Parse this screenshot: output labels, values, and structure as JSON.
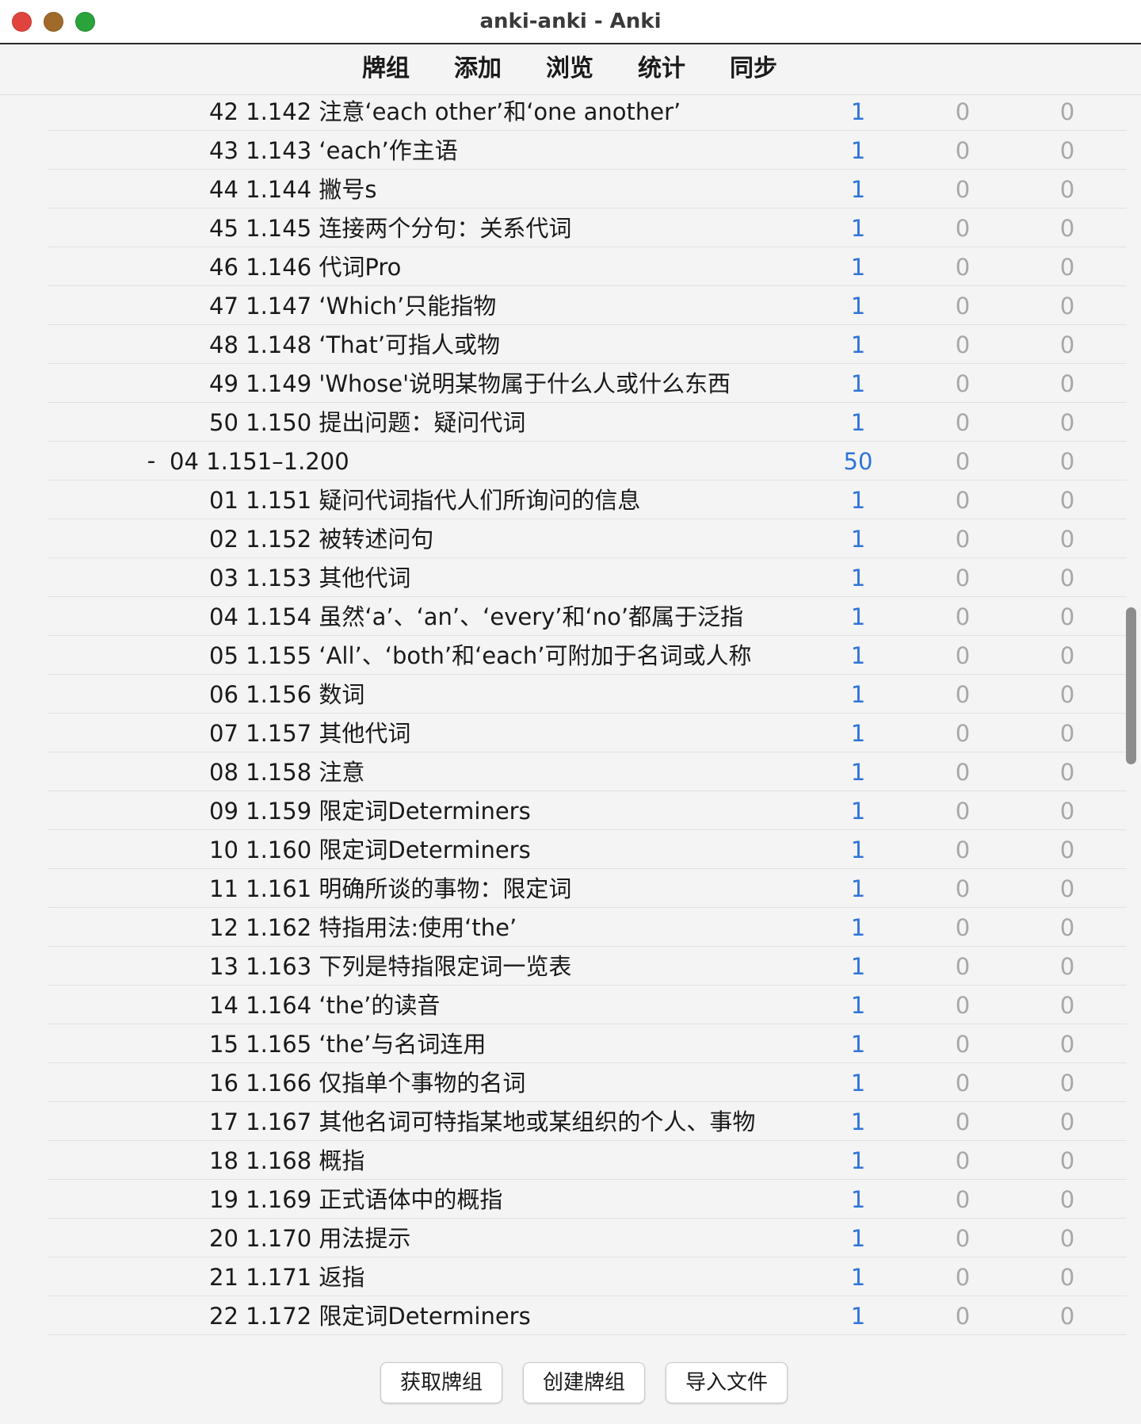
{
  "window": {
    "title": "anki-anki - Anki"
  },
  "toolbar": {
    "items": [
      {
        "label": "牌组"
      },
      {
        "label": "添加"
      },
      {
        "label": "浏览"
      },
      {
        "label": "统计"
      },
      {
        "label": "同步"
      }
    ]
  },
  "decks": {
    "rows": [
      {
        "name": "42 1.142 注意‘each other’和‘one another’",
        "new": "1",
        "learn": "0",
        "due": "0"
      },
      {
        "name": "43 1.143 ‘each’作主语",
        "new": "1",
        "learn": "0",
        "due": "0"
      },
      {
        "name": "44 1.144 撇号s",
        "new": "1",
        "learn": "0",
        "due": "0"
      },
      {
        "name": "45 1.145 连接两个分句：关系代词",
        "new": "1",
        "learn": "0",
        "due": "0"
      },
      {
        "name": "46 1.146 代词Pro",
        "new": "1",
        "learn": "0",
        "due": "0"
      },
      {
        "name": "47 1.147 ‘Which’只能指物",
        "new": "1",
        "learn": "0",
        "due": "0"
      },
      {
        "name": "48 1.148 ‘That’可指人或物",
        "new": "1",
        "learn": "0",
        "due": "0"
      },
      {
        "name": "49 1.149 'Whose'说明某物属于什么人或什么东西",
        "new": "1",
        "learn": "0",
        "due": "0"
      },
      {
        "name": "50 1.150 提出问题：疑问代词",
        "new": "1",
        "learn": "0",
        "due": "0"
      },
      {
        "name": "04 1.151–1.200",
        "new": "50",
        "learn": "0",
        "due": "0",
        "toggle": "-"
      },
      {
        "name": "01 1.151 疑问代词指代人们所询问的信息",
        "new": "1",
        "learn": "0",
        "due": "0"
      },
      {
        "name": "02 1.152 被转述问句",
        "new": "1",
        "learn": "0",
        "due": "0"
      },
      {
        "name": "03 1.153 其他代词",
        "new": "1",
        "learn": "0",
        "due": "0"
      },
      {
        "name": "04 1.154 虽然‘a’、‘an’、‘every’和‘no’都属于泛指",
        "new": "1",
        "learn": "0",
        "due": "0"
      },
      {
        "name": "05 1.155 ‘All’、‘both’和‘each’可附加于名词或人称",
        "new": "1",
        "learn": "0",
        "due": "0"
      },
      {
        "name": "06 1.156 数词",
        "new": "1",
        "learn": "0",
        "due": "0"
      },
      {
        "name": "07 1.157 其他代词",
        "new": "1",
        "learn": "0",
        "due": "0"
      },
      {
        "name": "08 1.158 注意",
        "new": "1",
        "learn": "0",
        "due": "0"
      },
      {
        "name": "09 1.159 限定词Determiners",
        "new": "1",
        "learn": "0",
        "due": "0"
      },
      {
        "name": "10 1.160 限定词Determiners",
        "new": "1",
        "learn": "0",
        "due": "0"
      },
      {
        "name": "11 1.161 明确所谈的事物：限定词",
        "new": "1",
        "learn": "0",
        "due": "0"
      },
      {
        "name": "12 1.162 特指用法:使用‘the’",
        "new": "1",
        "learn": "0",
        "due": "0"
      },
      {
        "name": "13 1.163 下列是特指限定词一览表",
        "new": "1",
        "learn": "0",
        "due": "0"
      },
      {
        "name": "14 1.164 ‘the’的读音",
        "new": "1",
        "learn": "0",
        "due": "0"
      },
      {
        "name": "15 1.165 ‘the’与名词连用",
        "new": "1",
        "learn": "0",
        "due": "0"
      },
      {
        "name": "16 1.166 仅指单个事物的名词",
        "new": "1",
        "learn": "0",
        "due": "0"
      },
      {
        "name": "17 1.167 其他名词可特指某地或某组织的个人、事物",
        "new": "1",
        "learn": "0",
        "due": "0"
      },
      {
        "name": "18 1.168 概指",
        "new": "1",
        "learn": "0",
        "due": "0"
      },
      {
        "name": "19 1.169 正式语体中的概指",
        "new": "1",
        "learn": "0",
        "due": "0"
      },
      {
        "name": "20 1.170 用法提示",
        "new": "1",
        "learn": "0",
        "due": "0"
      },
      {
        "name": "21 1.171 返指",
        "new": "1",
        "learn": "0",
        "due": "0"
      },
      {
        "name": "22 1.172 限定词Determiners",
        "new": "1",
        "learn": "0",
        "due": "0"
      }
    ]
  },
  "bottom": {
    "get_shared": "获取牌组",
    "create_deck": "创建牌组",
    "import_file": "导入文件"
  },
  "colors": {
    "new_count": "#2f74d9",
    "zero_count": "#a7a7a7",
    "close": "#e0443e",
    "minimize": "#a06a2a",
    "maximize": "#2aa33a"
  }
}
